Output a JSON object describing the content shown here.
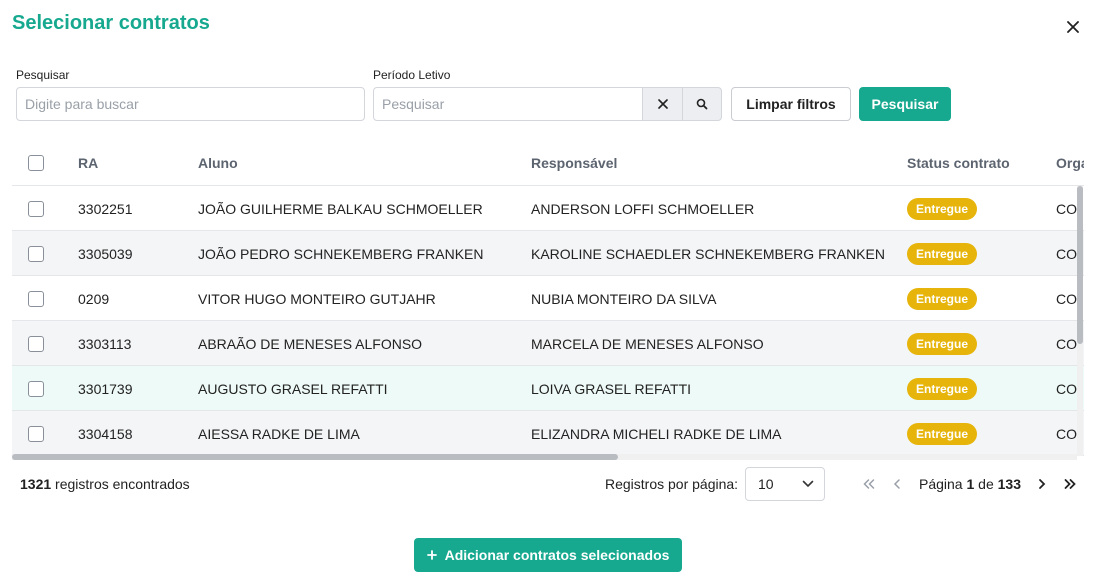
{
  "title": "Selecionar contratos",
  "close_icon": "close-icon",
  "filters": {
    "search_label": "Pesquisar",
    "search_placeholder": "Digite para buscar",
    "period_label": "Período Letivo",
    "period_placeholder": "Pesquisar",
    "clear_label": "Limpar filtros",
    "submit_label": "Pesquisar"
  },
  "table": {
    "columns": [
      "RA",
      "Aluno",
      "Responsável",
      "Status contrato",
      "Orga"
    ],
    "rows": [
      {
        "ra": "3302251",
        "aluno": "JOÃO GUILHERME BALKAU SCHMOELLER",
        "responsavel": "ANDERSON LOFFI SCHMOELLER",
        "status": "Entregue",
        "org": "COI"
      },
      {
        "ra": "3305039",
        "aluno": "JOÃO PEDRO SCHNEKEMBERG FRANKEN",
        "responsavel": "KAROLINE SCHAEDLER SCHNEKEMBERG FRANKEN",
        "status": "Entregue",
        "org": "COI"
      },
      {
        "ra": "0209",
        "aluno": "VITOR HUGO MONTEIRO GUTJAHR",
        "responsavel": "NUBIA MONTEIRO DA SILVA",
        "status": "Entregue",
        "org": "COI"
      },
      {
        "ra": "3303113",
        "aluno": "ABRAÃO DE MENESES ALFONSO",
        "responsavel": "MARCELA DE MENESES ALFONSO",
        "status": "Entregue",
        "org": "COI"
      },
      {
        "ra": "3301739",
        "aluno": "AUGUSTO GRASEL REFATTI",
        "responsavel": "LOIVA GRASEL REFATTI",
        "status": "Entregue",
        "org": "COI"
      },
      {
        "ra": "3304158",
        "aluno": "AIESSA RADKE DE LIMA",
        "responsavel": "ELIZANDRA MICHELI RADKE DE LIMA",
        "status": "Entregue",
        "org": "COI"
      }
    ]
  },
  "footer": {
    "count": "1321",
    "count_suffix": "registros encontrados",
    "per_page_label": "Registros por página:",
    "per_page_value": "10",
    "page_prefix": "Página",
    "page_current": "1",
    "page_of": "de",
    "page_total": "133"
  },
  "add_button_label": "Adicionar contratos selecionados",
  "colors": {
    "accent": "#16a98f",
    "badge": "#e6b40a",
    "row_alt": "#f4f5f7",
    "row_highlight": "#eefaf7"
  }
}
